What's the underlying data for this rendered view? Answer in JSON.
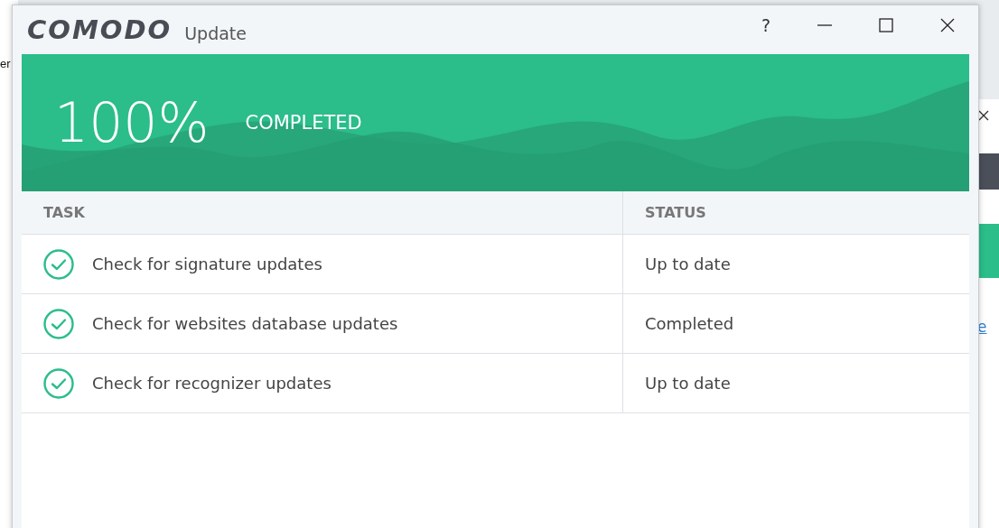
{
  "background_window": {
    "fragment_text": "er",
    "fragment_link": "e"
  },
  "window": {
    "brand": "COMODO",
    "title": "Update",
    "help": "?"
  },
  "banner": {
    "percent": "100%",
    "status": "COMPLETED"
  },
  "table": {
    "columns": [
      "TASK",
      "STATUS"
    ],
    "rows": [
      {
        "task": "Check for signature updates",
        "status": "Up to date"
      },
      {
        "task": "Check for websites database updates",
        "status": "Completed"
      },
      {
        "task": "Check for recognizer updates",
        "status": "Up to date"
      }
    ]
  }
}
